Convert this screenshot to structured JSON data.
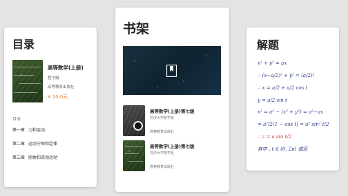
{
  "catalog": {
    "title": "目录",
    "book": {
      "title": "高等数学(上册)",
      "author": "程守娟",
      "publisher": "高等教育出版社",
      "price": "¥ 10.0元"
    },
    "toc_label": "目录",
    "chapters": [
      {
        "number": "第一章",
        "title": "力和运动"
      },
      {
        "number": "第二章",
        "title": "运动守恒和定律"
      },
      {
        "number": "第三章",
        "title": "刚体和流动运动"
      }
    ]
  },
  "bookshelf": {
    "title": "书架",
    "banner_icon": "bookmark-icon",
    "books": [
      {
        "title": "高等数学(上册)第七版",
        "school": "同济大学数学系",
        "publisher": "高等教育出版社"
      },
      {
        "title": "高等数学(上册)第七版",
        "school": "同济大学数学系",
        "publisher": "高等教育出版社"
      }
    ]
  },
  "solution": {
    "title": "解题",
    "lines": [
      "x² + y² = ax",
      "∴ (x−a/2)² + y² = (a/2)²",
      "∴ x = a/2 + a/2 cos t",
      "y = a/2 sin t",
      "x² = a² − (x² + y²) = a²−ax",
      "= a²/2(1 − cos t) = a² sin² t/2",
      "∴ z = a sin t/2",
      "其中 , t ∈ (0, 2π) 或区"
    ]
  },
  "colors": {
    "background": "#e4e4e4",
    "price": "#e8833a",
    "ink_blue": "#2a3a8c",
    "ink_red": "#d0392b"
  }
}
